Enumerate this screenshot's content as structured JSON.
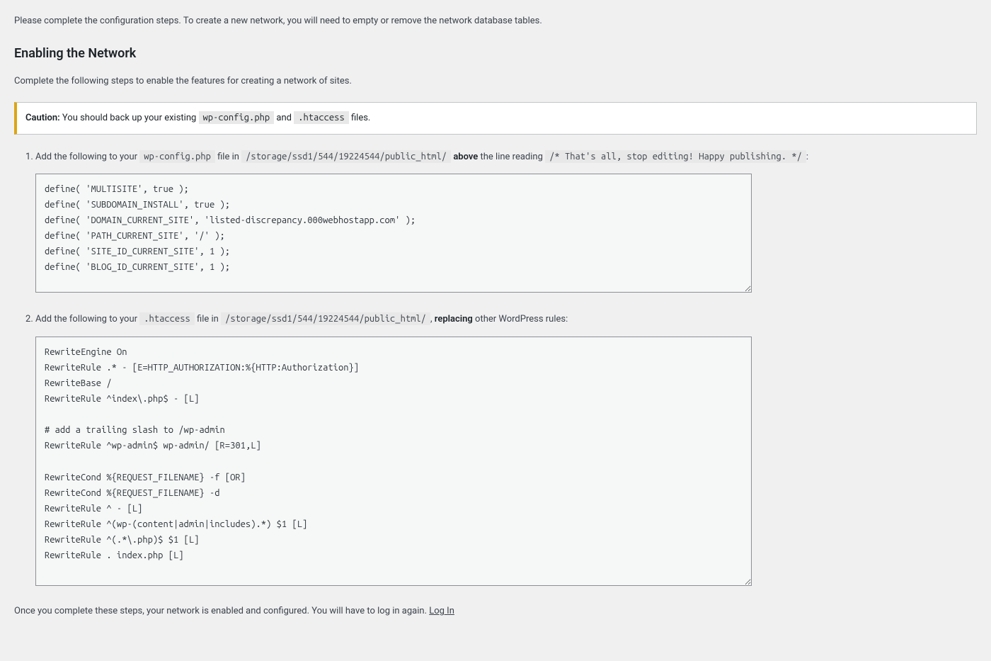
{
  "intro": "Please complete the configuration steps. To create a new network, you will need to empty or remove the network database tables.",
  "heading": "Enabling the Network",
  "subtext": "Complete the following steps to enable the features for creating a network of sites.",
  "notice": {
    "caution_label": "Caution:",
    "before": " You should back up your existing ",
    "file1": "wp-config.php",
    "middle": " and ",
    "file2": ".htaccess",
    "after": " files."
  },
  "step1": {
    "before": "Add the following to your ",
    "file": "wp-config.php",
    "filein": " file in ",
    "path": "/storage/ssd1/544/19224544/public_html/",
    "above_label": "above",
    "line_reading": " the line reading ",
    "stopline": "/* That's all, stop editing! Happy publishing. */",
    "colon": ":",
    "code": "define( 'MULTISITE', true );\ndefine( 'SUBDOMAIN_INSTALL', true );\ndefine( 'DOMAIN_CURRENT_SITE', 'listed-discrepancy.000webhostapp.com' );\ndefine( 'PATH_CURRENT_SITE', '/' );\ndefine( 'SITE_ID_CURRENT_SITE', 1 );\ndefine( 'BLOG_ID_CURRENT_SITE', 1 );\n"
  },
  "step2": {
    "before": "Add the following to your ",
    "file": ".htaccess",
    "filein": " file in ",
    "path": "/storage/ssd1/544/19224544/public_html/",
    "comma": ", ",
    "replacing_label": "replacing",
    "after": " other WordPress rules:",
    "code": "RewriteEngine On\nRewriteRule .* - [E=HTTP_AUTHORIZATION:%{HTTP:Authorization}]\nRewriteBase /\nRewriteRule ^index\\.php$ - [L]\n\n# add a trailing slash to /wp-admin\nRewriteRule ^wp-admin$ wp-admin/ [R=301,L]\n\nRewriteCond %{REQUEST_FILENAME} -f [OR]\nRewriteCond %{REQUEST_FILENAME} -d\nRewriteRule ^ - [L]\nRewriteRule ^(wp-(content|admin|includes).*) $1 [L]\nRewriteRule ^(.*\\.php)$ $1 [L]\nRewriteRule . index.php [L]\n"
  },
  "footer": {
    "text": "Once you complete these steps, your network is enabled and configured. You will have to log in again. ",
    "login_label": "Log In"
  }
}
